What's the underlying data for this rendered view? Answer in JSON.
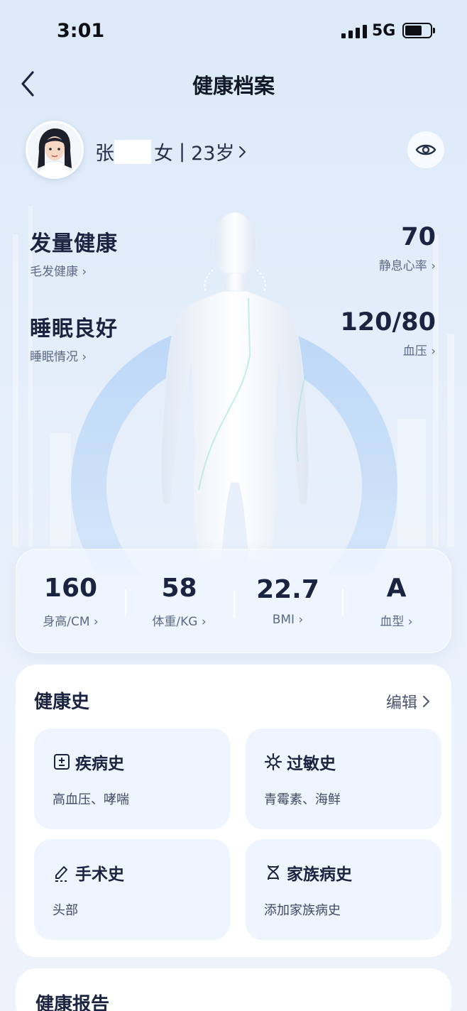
{
  "status_bar": {
    "time": "3:01",
    "network": "5G",
    "battery_level": 0.7
  },
  "nav": {
    "title": "健康档案",
    "back_icon": "chevron-left-icon"
  },
  "profile": {
    "surname": "张",
    "gender": "女",
    "separator": "|",
    "age": "23岁",
    "privacy_icon": "eye-icon"
  },
  "metrics": {
    "hair": {
      "value": "发量健康",
      "label": "毛发健康"
    },
    "heart_rate": {
      "value": "70",
      "label": "静息心率"
    },
    "sleep": {
      "value": "睡眠良好",
      "label": "睡眠情况"
    },
    "blood_pressure": {
      "value": "120/80",
      "label": "血压"
    }
  },
  "stats": [
    {
      "value": "160",
      "label": "身高/CM"
    },
    {
      "value": "58",
      "label": "体重/KG"
    },
    {
      "value": "22.7",
      "label": "BMI"
    },
    {
      "value": "A",
      "label": "血型"
    }
  ],
  "history": {
    "title": "健康史",
    "edit_label": "编辑",
    "items": [
      {
        "title": "疾病史",
        "desc": "高血压、哮喘",
        "icon": "medical-record-icon"
      },
      {
        "title": "过敏史",
        "desc": "青霉素、海鲜",
        "icon": "allergy-gear-icon"
      },
      {
        "title": "手术史",
        "desc": "头部",
        "icon": "scalpel-pen-icon"
      },
      {
        "title": "家族病史",
        "desc": "添加家族病史",
        "icon": "dna-icon"
      }
    ]
  },
  "report": {
    "title": "健康报告"
  },
  "colors": {
    "accent": "#1a2440",
    "card_bg": "#eff5ff",
    "ring": "#a9cbf3"
  }
}
